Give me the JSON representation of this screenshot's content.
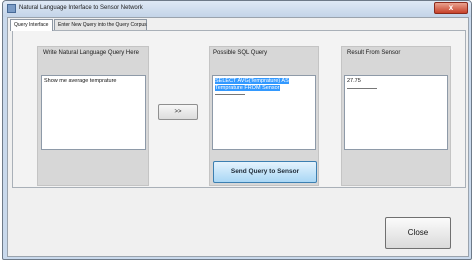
{
  "window": {
    "title": "Natural Language Interface to Sensor Network",
    "close_glyph": "x"
  },
  "tabs": [
    {
      "label": "Query Interface",
      "active": true
    },
    {
      "label": "Enter New Query into the Query Corpus",
      "active": false
    }
  ],
  "query_panel": {
    "label": "Write Natural Language Query Here",
    "value": "Show me average temprature"
  },
  "translate_button": {
    "label": ">>"
  },
  "sql_panel": {
    "label": "Possible SQL Query",
    "value": "SELECT AVG(Temprature) AS Temprature FROM Sensor"
  },
  "send_button": {
    "label": "Send Query to Sensor"
  },
  "result_panel": {
    "label": "Result From Sensor",
    "value": "27.75"
  },
  "close_button": {
    "label": "Close"
  }
}
